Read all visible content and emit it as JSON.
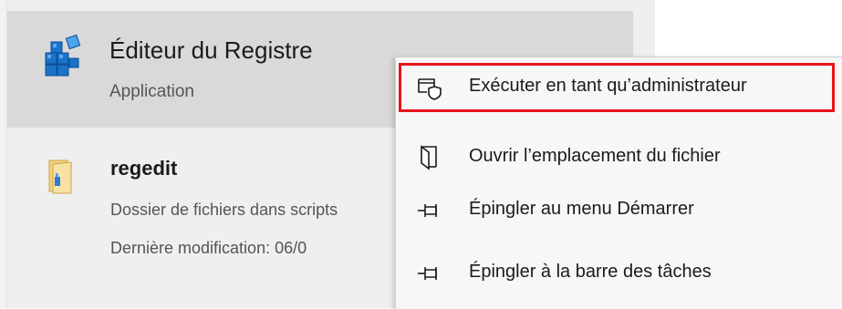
{
  "best_match": {
    "title": "Éditeur du Registre",
    "subtitle": "Application",
    "icon": "registry-editor-icon"
  },
  "folder_result": {
    "title": "regedit",
    "line1": "Dossier de fichiers dans scripts",
    "line2": "Dernière modification: 06/0",
    "icon": "folder-icon"
  },
  "context_menu": {
    "items": [
      {
        "label": "Exécuter en tant qu’administrateur",
        "icon": "run-as-admin-shield-icon"
      },
      {
        "label": "Ouvrir l’emplacement du fichier",
        "icon": "open-file-location-icon"
      },
      {
        "label": "Épingler au menu Démarrer",
        "icon": "pin-icon"
      },
      {
        "label": "Épingler à la barre des tâches",
        "icon": "pin-icon"
      }
    ]
  },
  "colors": {
    "highlight_border": "#e8141c",
    "selected_row": "#d9d9d9",
    "panel": "#efefef",
    "menu": "#f7f7f7"
  }
}
